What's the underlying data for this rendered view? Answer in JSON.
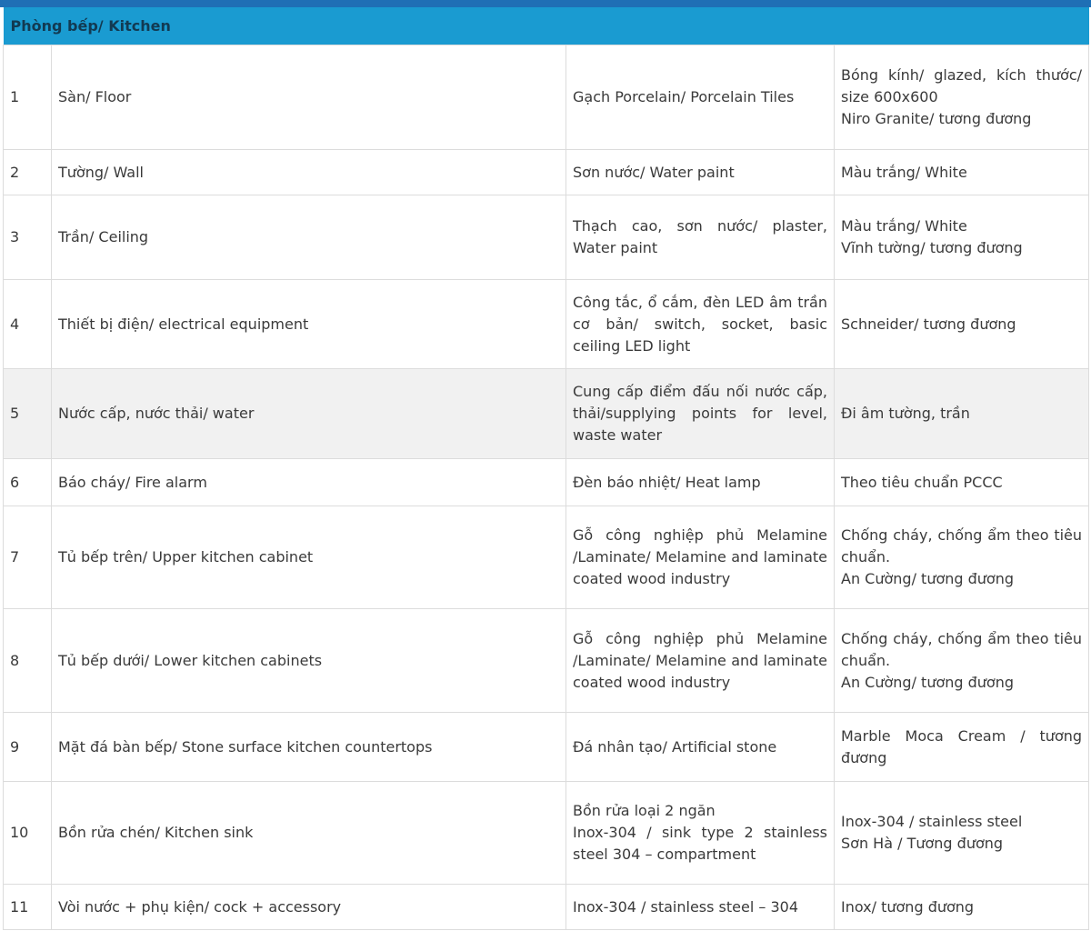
{
  "section_title": "Phòng bếp/ Kitchen",
  "rows": [
    {
      "no": "1",
      "item": "Sàn/ Floor",
      "material": [
        "Gạch Porcelain/ Porcelain Tiles"
      ],
      "brand": [
        "Bóng kính/ glazed, kích thước/ size 600x600",
        "Niro Granite/ tương đương"
      ]
    },
    {
      "no": "2",
      "item": "Tường/ Wall",
      "material": [
        "Sơn nước/ Water paint"
      ],
      "brand": [
        "Màu trắng/ White"
      ]
    },
    {
      "no": "3",
      "item": "Trần/ Ceiling",
      "material": [
        "Thạch cao, sơn nước/ plaster, Water paint"
      ],
      "brand": [
        "Màu trắng/ White",
        "Vĩnh tường/ tương đương"
      ]
    },
    {
      "no": "4",
      "item": "Thiết bị điện/ electrical equipment",
      "material": [
        "Công tắc, ổ cắm, đèn LED âm trần cơ bản/ switch, socket, basic ceiling LED light"
      ],
      "brand": [
        "Schneider/ tương đương"
      ]
    },
    {
      "no": "5",
      "item": "Nước cấp, nước thải/ water",
      "material": [
        "Cung cấp điểm đấu nối nước cấp, thải/supplying points for level, waste water"
      ],
      "brand": [
        "Đi âm tường, trần"
      ]
    },
    {
      "no": "6",
      "item": "Báo cháy/ Fire alarm",
      "material": [
        "Đèn báo nhiệt/ Heat lamp"
      ],
      "brand": [
        "Theo tiêu chuẩn PCCC"
      ]
    },
    {
      "no": "7",
      "item": "Tủ bếp trên/ Upper kitchen cabinet",
      "material": [
        "Gỗ công nghiệp phủ Melamine /Laminate/ Melamine and laminate coated wood industry"
      ],
      "brand": [
        "Chống cháy, chống ẩm theo tiêu chuẩn.",
        "An Cường/ tương đương"
      ]
    },
    {
      "no": "8",
      "item": "Tủ bếp dưới/ Lower kitchen cabinets",
      "material": [
        "Gỗ công nghiệp phủ Melamine /Laminate/ Melamine and laminate coated wood industry"
      ],
      "brand": [
        "Chống cháy, chống ẩm theo tiêu chuẩn.",
        "An Cường/ tương đương"
      ]
    },
    {
      "no": "9",
      "item": "Mặt đá bàn bếp/ Stone surface kitchen countertops",
      "material": [
        "Đá nhân tạo/ Artificial stone"
      ],
      "brand": [
        "Marble Moca Cream / tương đương"
      ]
    },
    {
      "no": "10",
      "item": "Bồn rửa chén/ Kitchen sink",
      "material": [
        "Bồn rửa loại 2 ngăn",
        "Inox-304 / sink type 2 stainless steel 304 – compartment"
      ],
      "brand": [
        "Inox-304 / stainless steel",
        "Sơn Hà / Tương đương"
      ]
    },
    {
      "no": "11",
      "item": "Vòi nước + phụ kiện/ cock + accessory",
      "material": [
        "Inox-304 / stainless steel – 304"
      ],
      "brand": [
        "Inox/ tương đương"
      ]
    }
  ]
}
